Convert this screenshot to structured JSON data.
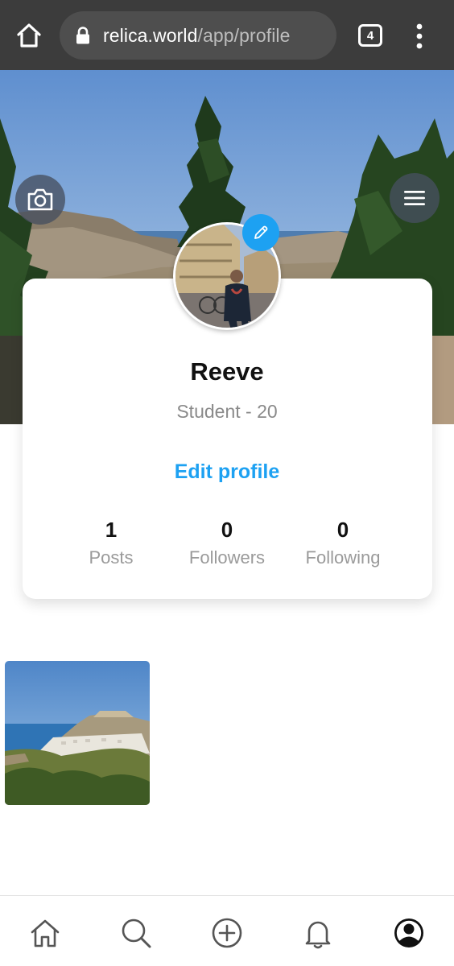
{
  "browser": {
    "url_domain": "relica.world",
    "url_path": "/app/profile",
    "tab_count": "4",
    "icons": [
      "home-icon",
      "lock-icon",
      "tabs-icon",
      "more-vert-icon"
    ]
  },
  "cover": {
    "icons": [
      "camera-icon",
      "hamburger-menu-icon"
    ]
  },
  "profile": {
    "name": "Reeve",
    "subtitle": "Student - 20",
    "edit_label": "Edit profile",
    "accent_color": "#1da1f2",
    "stats": [
      {
        "value": "1",
        "label": "Posts"
      },
      {
        "value": "0",
        "label": "Followers"
      },
      {
        "value": "0",
        "label": "Following"
      }
    ]
  },
  "bottom_nav": {
    "items": [
      "home-icon",
      "search-icon",
      "add-circle-icon",
      "bell-icon",
      "profile-icon"
    ],
    "active": "profile-icon"
  }
}
